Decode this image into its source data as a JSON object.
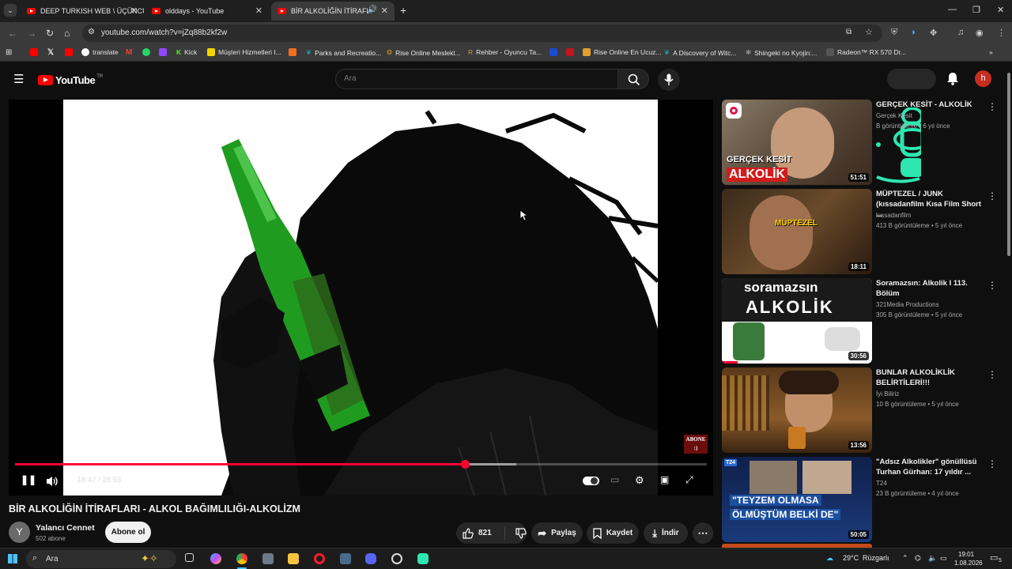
{
  "browser": {
    "tabs": [
      {
        "title": "DEEP TURKISH WEB \\ ÜÇÜNCÜ"
      },
      {
        "title": "olddays - YouTube"
      },
      {
        "title": "BİR ALKOLİĞİN İTİRAFLARI"
      }
    ],
    "new_tab_icon": "+",
    "url": "youtube.com/watch?v=jZq88b2kf2w",
    "bookmarks": [
      {
        "label": "",
        "icon": "youtube-icon",
        "color": "#ff0000"
      },
      {
        "label": "",
        "icon": "x-icon",
        "color": "#000000"
      },
      {
        "label": "",
        "icon": "youtube-icon",
        "color": "#ff0000"
      },
      {
        "label": "translate",
        "icon": "google-icon",
        "color": "#ffffff"
      },
      {
        "label": "",
        "icon": "gmail-icon",
        "color": "#ea4335"
      },
      {
        "label": "",
        "icon": "whatsapp-icon",
        "color": "#25d366"
      },
      {
        "label": "",
        "icon": "twitch-icon",
        "color": "#9146ff"
      },
      {
        "label": "Kick",
        "icon": "kick-icon",
        "color": "#53fc18"
      },
      {
        "label": "Müşteri Hizmetleri I...",
        "icon": "s-icon",
        "color": "#f5d400"
      },
      {
        "label": "",
        "icon": "k-icon",
        "color": "#f26d1f"
      },
      {
        "label": "Parks and Recreatio...",
        "icon": "leaf-icon",
        "color": "#1aa3a3"
      },
      {
        "label": "Rise Online Meslekl...",
        "icon": "rise-icon",
        "color": "#c88a2a"
      },
      {
        "label": "Rehber - Oyuncu Ta...",
        "icon": "r-icon",
        "color": "#a57c3a"
      },
      {
        "label": "",
        "icon": "b-icon",
        "color": "#1b4bd1"
      },
      {
        "label": "",
        "icon": "red-icon",
        "color": "#c4151c"
      },
      {
        "label": "Rise Online En Ucuz...",
        "icon": "shop-icon",
        "color": "#e0a030"
      },
      {
        "label": "A Discovery of Witc...",
        "icon": "leaf-icon",
        "color": "#1aa3a3"
      },
      {
        "label": "Shingeki no Kyojin:...",
        "icon": "settings-icon",
        "color": "#888888"
      },
      {
        "label": "Radeon™ RX 570 Dr...",
        "icon": "amd-icon",
        "color": "#444444"
      }
    ]
  },
  "youtube": {
    "logo_text": "YouTube",
    "logo_region": "TR",
    "search_placeholder": "Ara",
    "user_initial": "h",
    "player": {
      "time": "18:47 / 28:53",
      "progress_played": 0.65,
      "progress_buffered": 0.725,
      "badge": "ABONE :)"
    },
    "video": {
      "title": "BİR ALKOLİĞİN İTİRAFLARI - ALKOL BAĞIMLILIĞI-ALKOLİZM",
      "channel": "Yalancı Cennet",
      "channel_initial": "Y",
      "subscribers": "502 abone",
      "subscribe_label": "Abone ol",
      "likes": "821",
      "share_label": "Paylaş",
      "save_label": "Kaydet",
      "download_label": "İndir"
    },
    "sidebar": [
      {
        "title": "GERÇEK KESİT - ALKOLİK",
        "channel": "Gerçek Kesit",
        "meta": "B görüntüleme • 6 yıl önce",
        "duration": "51:51",
        "thumb_text": [
          "GERÇEK KESİT",
          "ALKOLİK"
        ]
      },
      {
        "title": "MÜPTEZEL / JUNK (kıssadanfilm Kısa Film Short ...",
        "channel": "kıssadanfilm",
        "meta": "413 B görüntüleme • 5 yıl önce",
        "duration": "18:11",
        "thumb_text": [
          "MÜPTEZEL"
        ]
      },
      {
        "title": "Soramazsın: Alkolik I 113. Bölüm",
        "channel": "321Media Productions",
        "meta": "305 B görüntüleme • 5 yıl önce",
        "duration": "30:56",
        "thumb_text": [
          "soramazsın",
          "ALKOLİK"
        ]
      },
      {
        "title": "BUNLAR ALKOLİKLİK BELİRTİLERİ!!!",
        "channel": "İyi Biliriz",
        "meta": "10 B görüntüleme • 5 yıl önce",
        "duration": "13:56",
        "thumb_text": []
      },
      {
        "title": "\"Adsız Alkolikler\" gönüllüsü Turhan Gürhan: 17 yıldır ...",
        "channel": "T24",
        "meta": "23 B görüntüleme • 4 yıl önce",
        "duration": "50:05",
        "thumb_text": [
          "\"TEYZEM OLMASA",
          "ÖLMÜŞTÜM BELKİ DE\""
        ]
      }
    ]
  },
  "taskbar": {
    "search_placeholder": "Ara",
    "weather": "29°C",
    "wind": "Rüzgarlı",
    "time": "19:01",
    "date": "1.08.2026",
    "notifications": "5"
  }
}
